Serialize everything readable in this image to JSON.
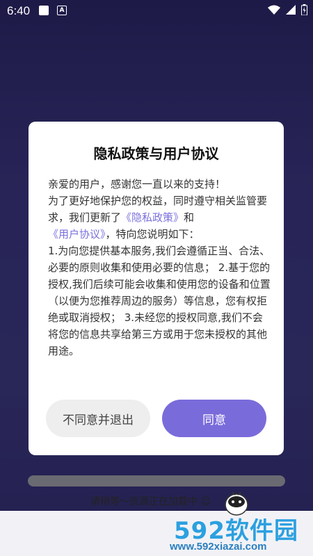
{
  "statusbar": {
    "time": "6:40",
    "icons": [
      "notification-square-icon",
      "notification-a-icon",
      "wifi-icon",
      "signal-icon",
      "battery-icon"
    ]
  },
  "dialog": {
    "title": "隐私政策与用户协议",
    "greeting": "亲爱的用户，感谢您一直以来的支持！",
    "intro_before_links": "为了更好地保护您的权益，同时遵守相关监管要求，我们更新了",
    "privacy_link": "《隐私政策》",
    "and_text": "和",
    "agreement_link": "《用户协议》",
    "intro_after_links": "，特向您说明如下：",
    "clauses": " 1.为向您提供基本服务,我们会遵循正当、合法、必要的原则收集和使用必要的信息； 2.基于您的授权,我们后续可能会收集和使用您的设备和位置（以便为您推荐周边的服务）等信息，您有权拒绝或取消授权； 3.未经您的授权同意,我们不会将您的信息共享给第三方或用于您未授权的其他用途。",
    "decline_label": "不同意并退出",
    "agree_label": "同意"
  },
  "loading": {
    "text": "请稍等～资源正在加载中 ☺",
    "progress": 0
  },
  "watermark": {
    "brand": "592软件园",
    "url": "www.592xiazai.com"
  },
  "colors": {
    "accent": "#7a6bdb",
    "link": "#7a70dd",
    "background": "#3a3478"
  }
}
